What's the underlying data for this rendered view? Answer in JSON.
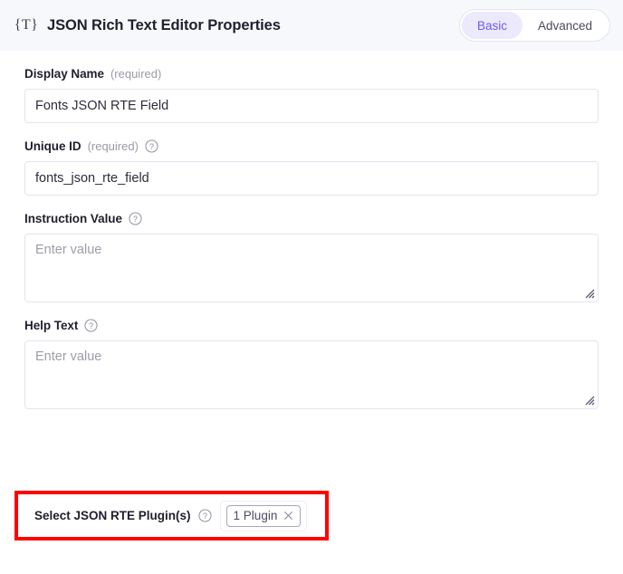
{
  "header": {
    "icon": "json-braces-t-icon",
    "title": "JSON Rich Text Editor Properties",
    "icon_text": "{T}",
    "tabs": [
      {
        "label": "Basic",
        "active": true
      },
      {
        "label": "Advanced",
        "active": false
      }
    ],
    "accent_color": "#6c5ce7",
    "active_tab_bg": "#ece9fd",
    "background": "#f7f8fc"
  },
  "form": {
    "display_name": {
      "label": "Display Name",
      "required_text": "(required)",
      "value": "Fonts JSON RTE Field",
      "placeholder": "Enter value"
    },
    "unique_id": {
      "label": "Unique ID",
      "required_text": "(required)",
      "value": "fonts_json_rte_field",
      "placeholder": "Enter value",
      "help_icon": "question-mark-circle-icon"
    },
    "instruction_value": {
      "label": "Instruction Value",
      "value": "",
      "placeholder": "Enter value",
      "help_icon": "question-mark-circle-icon"
    },
    "help_text": {
      "label": "Help Text",
      "value": "",
      "placeholder": "Enter value",
      "help_icon": "question-mark-circle-icon"
    },
    "plugins": {
      "label": "Select JSON RTE Plugin(s)",
      "help_icon": "question-mark-circle-icon",
      "chip_label": "1 Plugin",
      "chip_close_icon": "close-x-icon",
      "highlight_color": "#ff0000"
    }
  }
}
